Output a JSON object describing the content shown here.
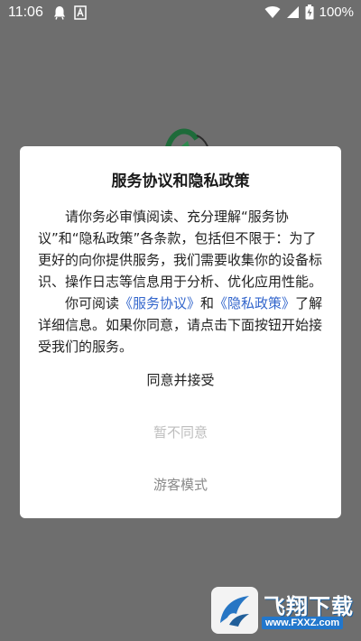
{
  "status_bar": {
    "time": "11:06",
    "battery_text": "100%",
    "icons": [
      "notification-icon",
      "app-icon",
      "wifi-icon",
      "signal-icon",
      "battery-icon"
    ]
  },
  "dialog": {
    "title": "服务协议和隐私政策",
    "paragraph1": "请你务必审慎阅读、充分理解“服务协议”和“隐私政策”各条款，包括但不限于：为了更好的向你提供服务，我们需要收集你的设备标识、操作日志等信息用于分析、优化应用性能。",
    "paragraph2_prefix": "你可阅读",
    "link_terms": "《服务协议》",
    "paragraph2_and": "和",
    "link_privacy": "《隐私政策》",
    "paragraph2_suffix": "了解详细信息。如果你同意，请点击下面按钮开始接受我们的服务。",
    "accept_label": "同意并接受",
    "decline_label": "暂不同意",
    "guest_label": "游客模式"
  },
  "watermark": {
    "title": "飞翔下载",
    "url": "www.FXXZ.com"
  },
  "colors": {
    "link": "#3366cc",
    "overlay": "#6e6e6e",
    "decline": "#bdbdbd"
  }
}
